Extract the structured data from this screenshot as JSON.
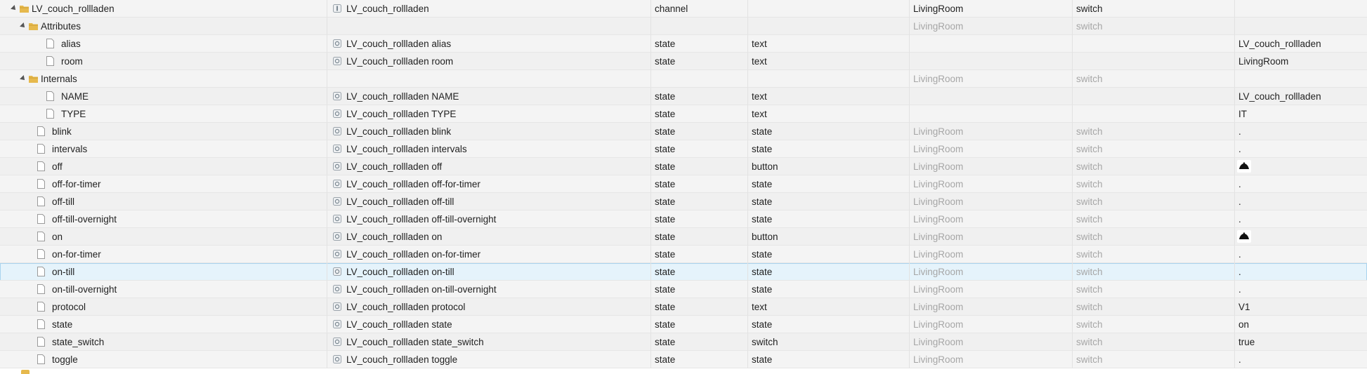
{
  "tree": {
    "rows": [
      {
        "name": "LV_couch_rollladen",
        "kind": "folder",
        "depth": 0,
        "expanded": true,
        "id_icon": "channel-icon",
        "id_text": "LV_couch_rollladen",
        "type": "channel",
        "role": "",
        "room": "LivingRoom",
        "room_muted": false,
        "function": "switch",
        "function_muted": false,
        "value": "",
        "value_icon": false
      },
      {
        "name": "Attributes",
        "kind": "folder",
        "depth": 1,
        "expanded": true,
        "id_icon": "",
        "id_text": "",
        "type": "",
        "role": "",
        "room": "LivingRoom",
        "room_muted": true,
        "function": "switch",
        "function_muted": true,
        "value": "",
        "value_icon": false
      },
      {
        "name": "alias",
        "kind": "file",
        "depth": 2,
        "id_icon": "state-icon",
        "id_text": "LV_couch_rollladen alias",
        "type": "state",
        "role": "text",
        "room": "",
        "room_muted": true,
        "function": "",
        "function_muted": true,
        "value": "LV_couch_rollladen",
        "value_icon": false
      },
      {
        "name": "room",
        "kind": "file",
        "depth": 2,
        "id_icon": "state-icon",
        "id_text": "LV_couch_rollladen room",
        "type": "state",
        "role": "text",
        "room": "",
        "room_muted": true,
        "function": "",
        "function_muted": true,
        "value": "LivingRoom",
        "value_icon": false
      },
      {
        "name": "Internals",
        "kind": "folder",
        "depth": 1,
        "expanded": true,
        "id_icon": "",
        "id_text": "",
        "type": "",
        "role": "",
        "room": "LivingRoom",
        "room_muted": true,
        "function": "switch",
        "function_muted": true,
        "value": "",
        "value_icon": false
      },
      {
        "name": "NAME",
        "kind": "file",
        "depth": 2,
        "id_icon": "state-icon",
        "id_text": "LV_couch_rollladen NAME",
        "type": "state",
        "role": "text",
        "room": "",
        "room_muted": true,
        "function": "",
        "function_muted": true,
        "value": "LV_couch_rollladen",
        "value_icon": false
      },
      {
        "name": "TYPE",
        "kind": "file",
        "depth": 2,
        "id_icon": "state-icon",
        "id_text": "LV_couch_rollladen TYPE",
        "type": "state",
        "role": "text",
        "room": "",
        "room_muted": true,
        "function": "",
        "function_muted": true,
        "value": "IT",
        "value_icon": false
      },
      {
        "name": "blink",
        "kind": "file",
        "depth": 1,
        "id_icon": "state-icon",
        "id_text": "LV_couch_rollladen blink",
        "type": "state",
        "role": "state",
        "room": "LivingRoom",
        "room_muted": true,
        "function": "switch",
        "function_muted": true,
        "value": ".",
        "value_icon": false
      },
      {
        "name": "intervals",
        "kind": "file",
        "depth": 1,
        "id_icon": "state-icon",
        "id_text": "LV_couch_rollladen intervals",
        "type": "state",
        "role": "state",
        "room": "LivingRoom",
        "room_muted": true,
        "function": "switch",
        "function_muted": true,
        "value": ".",
        "value_icon": false
      },
      {
        "name": "off",
        "kind": "file",
        "depth": 1,
        "id_icon": "state-icon",
        "id_text": "LV_couch_rollladen off",
        "type": "state",
        "role": "button",
        "room": "LivingRoom",
        "room_muted": true,
        "function": "switch",
        "function_muted": true,
        "value": "",
        "value_icon": true
      },
      {
        "name": "off-for-timer",
        "kind": "file",
        "depth": 1,
        "id_icon": "state-icon",
        "id_text": "LV_couch_rollladen off-for-timer",
        "type": "state",
        "role": "state",
        "room": "LivingRoom",
        "room_muted": true,
        "function": "switch",
        "function_muted": true,
        "value": ".",
        "value_icon": false
      },
      {
        "name": "off-till",
        "kind": "file",
        "depth": 1,
        "id_icon": "state-icon",
        "id_text": "LV_couch_rollladen off-till",
        "type": "state",
        "role": "state",
        "room": "LivingRoom",
        "room_muted": true,
        "function": "switch",
        "function_muted": true,
        "value": ".",
        "value_icon": false
      },
      {
        "name": "off-till-overnight",
        "kind": "file",
        "depth": 1,
        "id_icon": "state-icon",
        "id_text": "LV_couch_rollladen off-till-overnight",
        "type": "state",
        "role": "state",
        "room": "LivingRoom",
        "room_muted": true,
        "function": "switch",
        "function_muted": true,
        "value": ".",
        "value_icon": false
      },
      {
        "name": "on",
        "kind": "file",
        "depth": 1,
        "id_icon": "state-icon",
        "id_text": "LV_couch_rollladen on",
        "type": "state",
        "role": "button",
        "room": "LivingRoom",
        "room_muted": true,
        "function": "switch",
        "function_muted": true,
        "value": "",
        "value_icon": true
      },
      {
        "name": "on-for-timer",
        "kind": "file",
        "depth": 1,
        "id_icon": "state-icon",
        "id_text": "LV_couch_rollladen on-for-timer",
        "type": "state",
        "role": "state",
        "room": "LivingRoom",
        "room_muted": true,
        "function": "switch",
        "function_muted": true,
        "value": ".",
        "value_icon": false
      },
      {
        "name": "on-till",
        "kind": "file",
        "depth": 1,
        "selected": true,
        "id_icon": "state-icon",
        "id_text": "LV_couch_rollladen on-till",
        "type": "state",
        "role": "state",
        "room": "LivingRoom",
        "room_muted": true,
        "function": "switch",
        "function_muted": true,
        "value": ".",
        "value_icon": false
      },
      {
        "name": "on-till-overnight",
        "kind": "file",
        "depth": 1,
        "id_icon": "state-icon",
        "id_text": "LV_couch_rollladen on-till-overnight",
        "type": "state",
        "role": "state",
        "room": "LivingRoom",
        "room_muted": true,
        "function": "switch",
        "function_muted": true,
        "value": ".",
        "value_icon": false
      },
      {
        "name": "protocol",
        "kind": "file",
        "depth": 1,
        "id_icon": "state-icon",
        "id_text": "LV_couch_rollladen protocol",
        "type": "state",
        "role": "text",
        "room": "LivingRoom",
        "room_muted": true,
        "function": "switch",
        "function_muted": true,
        "value": "V1",
        "value_icon": false
      },
      {
        "name": "state",
        "kind": "file",
        "depth": 1,
        "id_icon": "state-icon",
        "id_text": "LV_couch_rollladen state",
        "type": "state",
        "role": "state",
        "room": "LivingRoom",
        "room_muted": true,
        "function": "switch",
        "function_muted": true,
        "value": "on",
        "value_icon": false
      },
      {
        "name": "state_switch",
        "kind": "file",
        "depth": 1,
        "id_icon": "state-icon",
        "id_text": "LV_couch_rollladen state_switch",
        "type": "state",
        "role": "switch",
        "room": "LivingRoom",
        "room_muted": true,
        "function": "switch",
        "function_muted": true,
        "value": "true",
        "value_icon": false
      },
      {
        "name": "toggle",
        "kind": "file",
        "depth": 1,
        "id_icon": "state-icon",
        "id_text": "LV_couch_rollladen toggle",
        "type": "state",
        "role": "state",
        "room": "LivingRoom",
        "room_muted": true,
        "function": "switch",
        "function_muted": true,
        "value": ".",
        "value_icon": false
      }
    ]
  },
  "colors": {
    "folder": "#e6b94d",
    "folder_dark": "#c99a2e",
    "row_bg": "#f4f4f4",
    "selected_bg": "#e5f3fb",
    "selected_border": "#a9d3ee",
    "muted_text": "#a6a6a6",
    "text": "#1f1f1f"
  }
}
